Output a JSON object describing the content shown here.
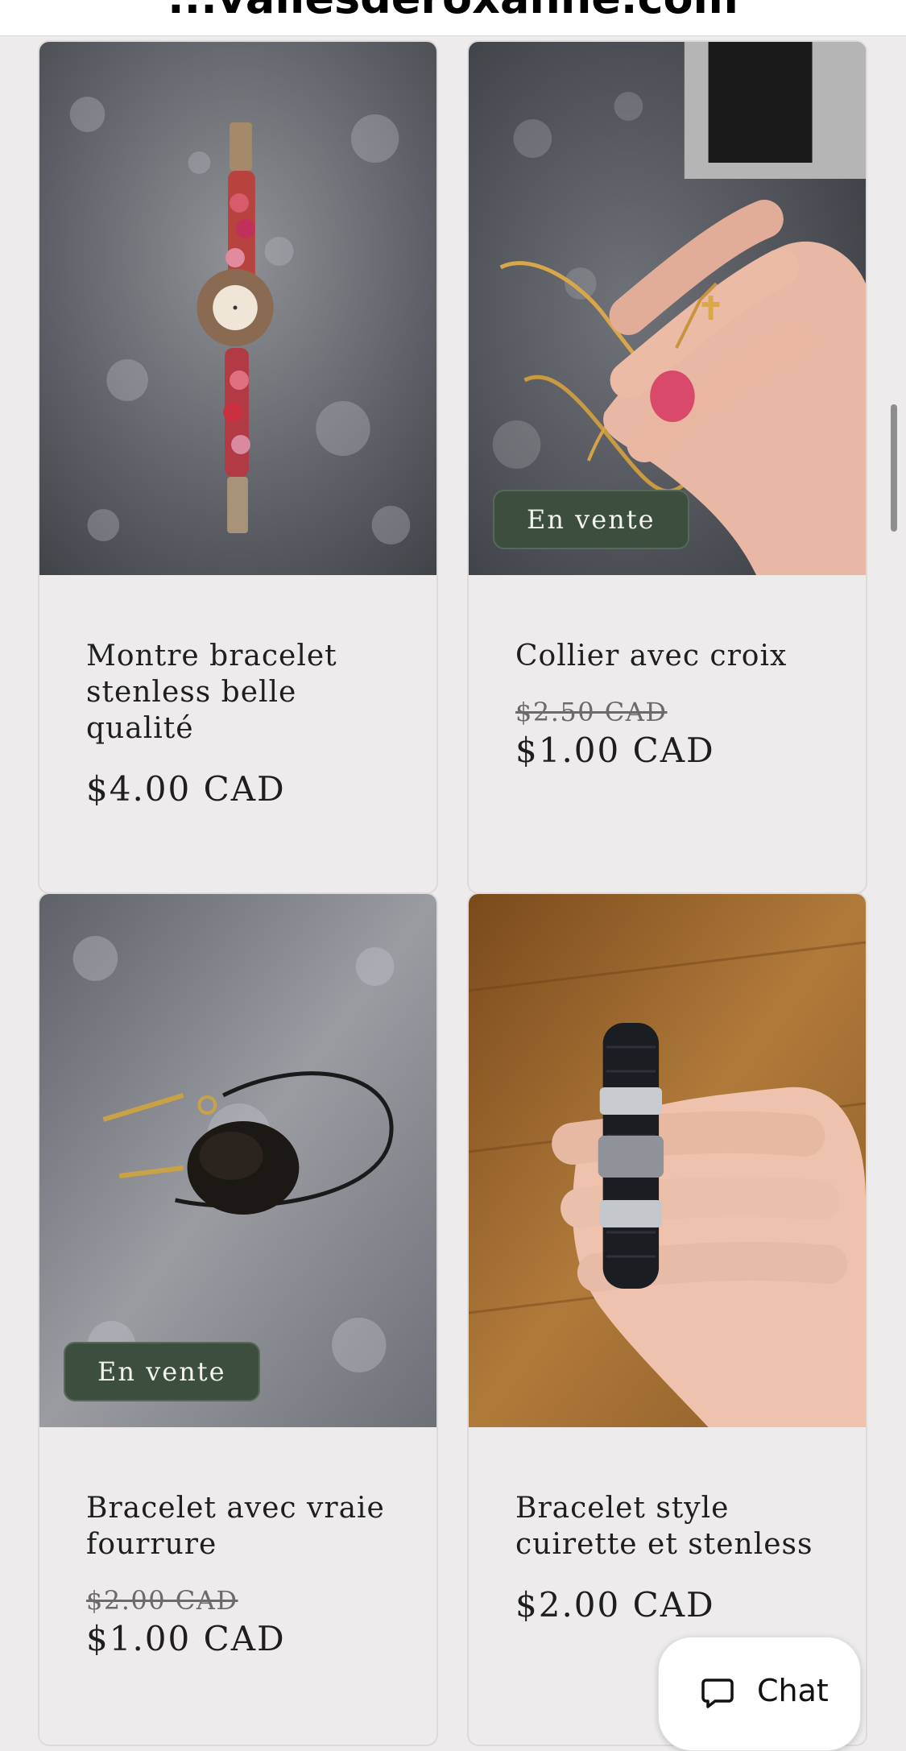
{
  "browser": {
    "url_fragment": "...vallesderoxanne.com"
  },
  "products": [
    {
      "title": "Montre bracelet stenless belle qualité",
      "badge": "",
      "compare_price": "",
      "price": "$4.00 CAD",
      "image": "watch-photo"
    },
    {
      "title": "Collier avec croix",
      "badge": "En vente",
      "compare_price": "$2.50 CAD",
      "price": "$1.00 CAD",
      "image": "gold-necklace-photo"
    },
    {
      "title": "Bracelet avec vraie fourrure",
      "badge": "En vente",
      "compare_price": "$2.00 CAD",
      "price": "$1.00 CAD",
      "image": "fur-bracelet-photo"
    },
    {
      "title": "Bracelet style cuirette et stenless",
      "badge": "",
      "compare_price": "",
      "price": "$2.00 CAD",
      "image": "leather-bracelet-photo"
    }
  ],
  "chat": {
    "label": "Chat",
    "icon": "chat-bubble-icon"
  },
  "colors": {
    "background": "#edebec",
    "badge": "#3c4f3f",
    "text": "#1e1e1e"
  }
}
